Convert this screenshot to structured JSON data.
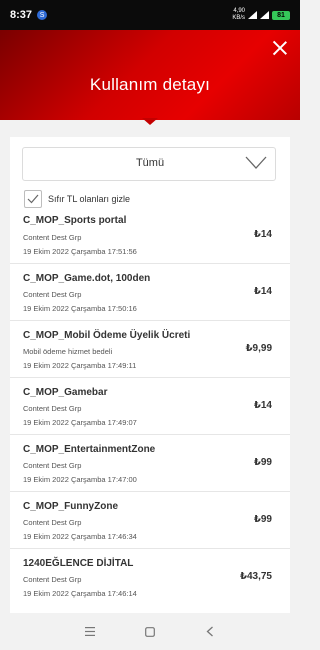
{
  "status_bar": {
    "time": "8:37",
    "app_badge": "S",
    "net_speed_top": "4,90",
    "net_speed_bottom": "KB/s",
    "battery": "81"
  },
  "header": {
    "title": "Kullanım detayı"
  },
  "filter": {
    "selected": "Tümü"
  },
  "hide_zero": {
    "label": "Sıfır TL olanları gizle",
    "checked": true
  },
  "items": [
    {
      "name": "C_MOP_Sports portal",
      "category": "Content Dest Grp",
      "date": "19 Ekim 2022 Çarşamba 17:51:56",
      "amount": "₺14"
    },
    {
      "name": "C_MOP_Game.dot, 100den",
      "category": "Content Dest Grp",
      "date": "19 Ekim 2022 Çarşamba 17:50:16",
      "amount": "₺14"
    },
    {
      "name": "C_MOP_Mobil Ödeme Üyelik Ücreti",
      "category": "Mobil ödeme hizmet bedeli",
      "date": "19 Ekim 2022 Çarşamba 17:49:11",
      "amount": "₺9,99"
    },
    {
      "name": "C_MOP_Gamebar",
      "category": "Content Dest Grp",
      "date": "19 Ekim 2022 Çarşamba 17:49:07",
      "amount": "₺14"
    },
    {
      "name": "C_MOP_EntertainmentZone",
      "category": "Content Dest Grp",
      "date": "19 Ekim 2022 Çarşamba 17:47:00",
      "amount": "₺99"
    },
    {
      "name": "C_MOP_FunnyZone",
      "category": "Content Dest Grp",
      "date": "19 Ekim 2022 Çarşamba 17:46:34",
      "amount": "₺99"
    },
    {
      "name": "1240EĞLENCE DİJİTAL",
      "category": "Content Dest Grp",
      "date": "19 Ekim 2022 Çarşamba 17:46:14",
      "amount": "₺43,75"
    }
  ],
  "colors": {
    "brand_red": "#e60000",
    "header_dark_red": "#7a0000"
  },
  "icons": {
    "close": "close-icon",
    "dropdown": "chevron-down-icon",
    "checkbox": "checkmark-icon",
    "nav_menu": "menu-icon",
    "nav_home": "home-square-icon",
    "nav_back": "back-chevron-icon"
  }
}
